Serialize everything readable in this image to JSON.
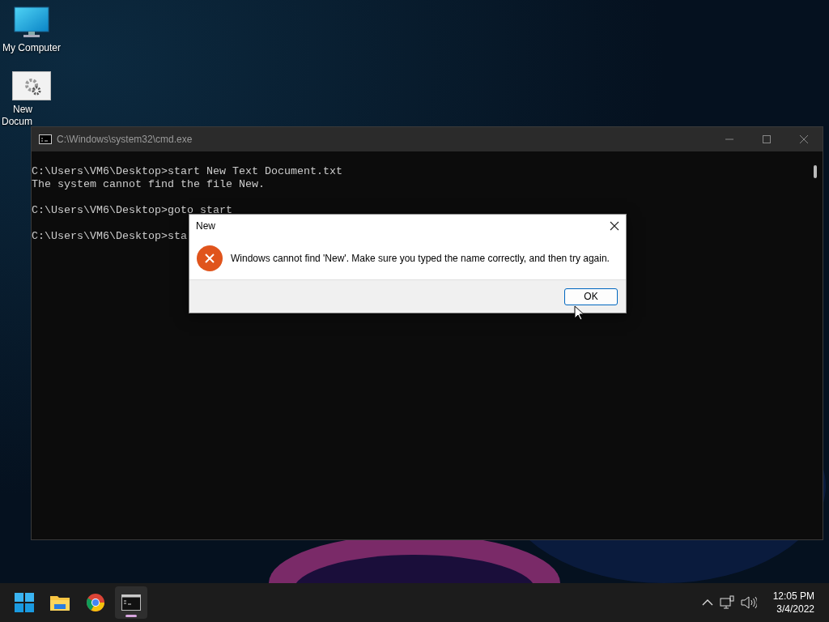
{
  "desktop_icons": [
    {
      "kind": "computer",
      "label": "My Computer"
    },
    {
      "kind": "document",
      "label": "New Docum"
    }
  ],
  "cmd_window": {
    "title": "C:\\Windows\\system32\\cmd.exe",
    "blocks": [
      [
        "C:\\Users\\VM6\\Desktop>start New Text Document.txt",
        "The system cannot find the file New."
      ],
      [
        "C:\\Users\\VM6\\Desktop>goto start"
      ],
      [
        "C:\\Users\\VM6\\Desktop>sta"
      ]
    ]
  },
  "dialog": {
    "title": "New",
    "message": "Windows cannot find 'New'. Make sure you typed the name correctly, and then try again.",
    "button": "OK"
  },
  "taskbar": {
    "apps": [
      {
        "kind": "start",
        "active": false
      },
      {
        "kind": "explorer",
        "active": false
      },
      {
        "kind": "browser",
        "active": false
      },
      {
        "kind": "terminal",
        "active": true
      }
    ],
    "time": "12:05 PM",
    "date": "3/4/2022"
  }
}
